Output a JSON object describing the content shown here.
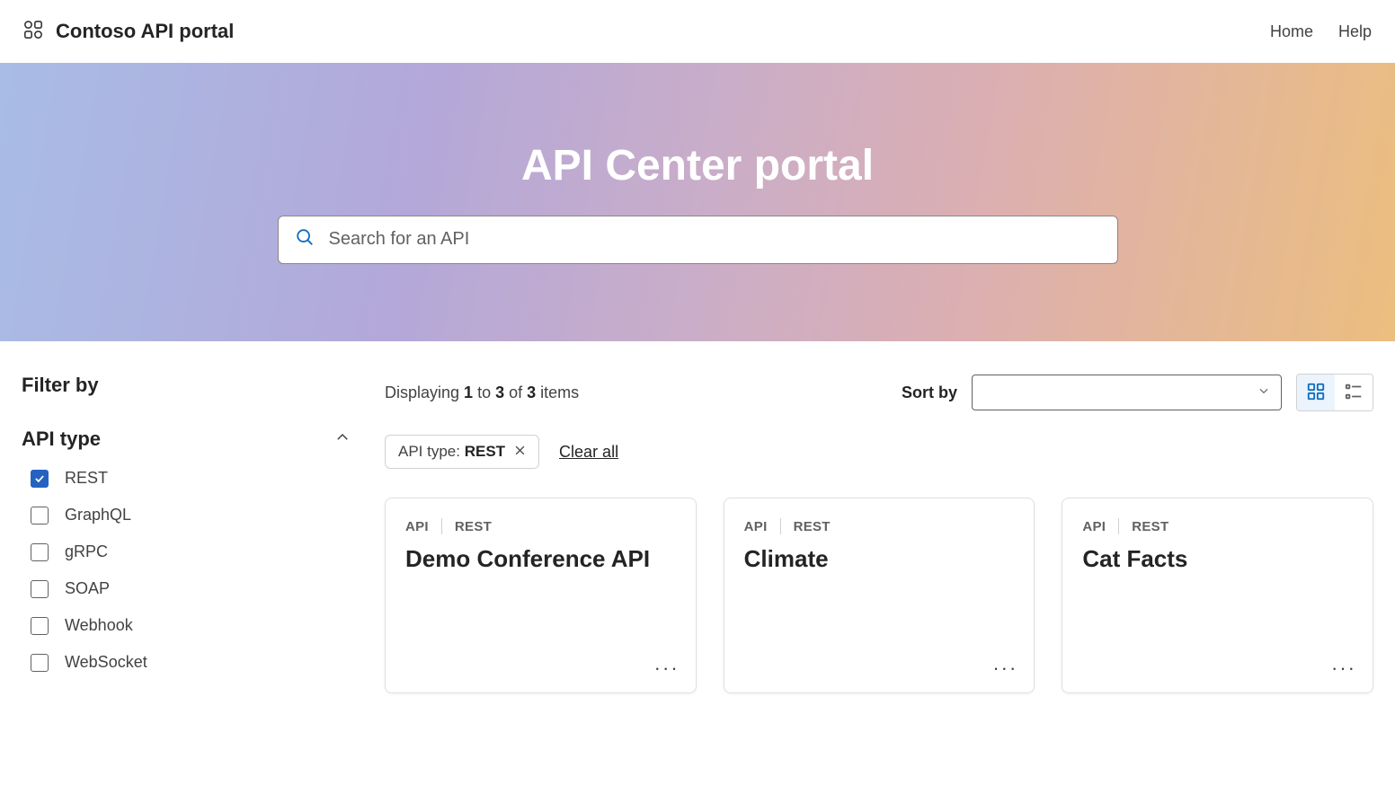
{
  "nav": {
    "brand": "Contoso API portal",
    "links": [
      "Home",
      "Help"
    ]
  },
  "hero": {
    "title": "API Center portal",
    "search_placeholder": "Search for an API"
  },
  "sidebar": {
    "title": "Filter by",
    "filter_group": {
      "title": "API type",
      "options": [
        {
          "label": "REST",
          "checked": true
        },
        {
          "label": "GraphQL",
          "checked": false
        },
        {
          "label": "gRPC",
          "checked": false
        },
        {
          "label": "SOAP",
          "checked": false
        },
        {
          "label": "Webhook",
          "checked": false
        },
        {
          "label": "WebSocket",
          "checked": false
        }
      ]
    }
  },
  "results": {
    "count_prefix": "Displaying ",
    "count_from": "1",
    "count_to_word": " to ",
    "count_to": "3",
    "count_of_word": " of ",
    "count_total": "3",
    "count_suffix": " items",
    "sort_label": "Sort by",
    "chips": [
      {
        "label": "API type: ",
        "value": "REST"
      }
    ],
    "clear_all": "Clear all",
    "cards": [
      {
        "badge1": "API",
        "badge2": "REST",
        "title": "Demo Conference API"
      },
      {
        "badge1": "API",
        "badge2": "REST",
        "title": "Climate"
      },
      {
        "badge1": "API",
        "badge2": "REST",
        "title": "Cat Facts"
      }
    ]
  }
}
